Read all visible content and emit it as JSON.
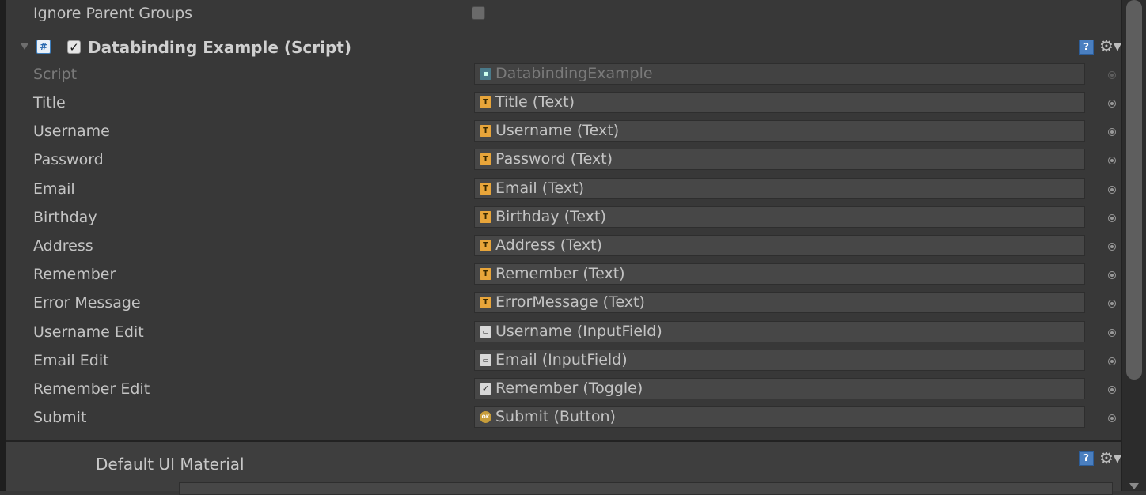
{
  "ignore_parent": {
    "label": "Ignore Parent Groups",
    "checked": false
  },
  "component": {
    "title": "Databinding Example (Script)",
    "enabled": true,
    "icons": {
      "foldout": "foldout-arrow-icon",
      "script": "csharp-script-icon",
      "help": "help-icon",
      "settings": "gear-icon"
    }
  },
  "script_row": {
    "label": "Script",
    "value": "DatabindingExample",
    "icon": "script-icon"
  },
  "fields": [
    {
      "label": "Title",
      "value": "Title (Text)",
      "type": "text"
    },
    {
      "label": "Username",
      "value": "Username (Text)",
      "type": "text"
    },
    {
      "label": "Password",
      "value": "Password (Text)",
      "type": "text"
    },
    {
      "label": "Email",
      "value": "Email (Text)",
      "type": "text"
    },
    {
      "label": "Birthday",
      "value": "Birthday (Text)",
      "type": "text"
    },
    {
      "label": "Address",
      "value": "Address (Text)",
      "type": "text"
    },
    {
      "label": "Remember",
      "value": "Remember (Text)",
      "type": "text"
    },
    {
      "label": "Error Message",
      "value": "ErrorMessage (Text)",
      "type": "text"
    },
    {
      "label": "Username Edit",
      "value": "Username (InputField)",
      "type": "input"
    },
    {
      "label": "Email Edit",
      "value": "Email (InputField)",
      "type": "input"
    },
    {
      "label": "Remember Edit",
      "value": "Remember (Toggle)",
      "type": "toggle"
    },
    {
      "label": "Submit",
      "value": "Submit (Button)",
      "type": "button"
    }
  ],
  "material": {
    "title": "Default UI Material"
  }
}
